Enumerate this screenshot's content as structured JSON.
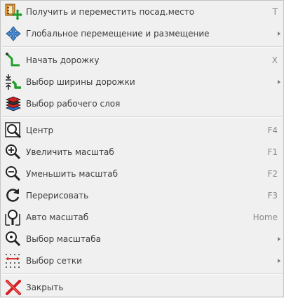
{
  "menu": {
    "items": [
      {
        "label": "Получить и переместить посад.место",
        "shortcut": "T",
        "icon": "get-footprint-icon"
      },
      {
        "label": "Глобальное перемещение и размещение",
        "shortcut": "",
        "icon": "move-arrows-icon",
        "submenu": true
      },
      {
        "label": "Начать дорожку",
        "shortcut": "X",
        "icon": "track-icon"
      },
      {
        "label": "Выбор ширины дорожки",
        "shortcut": "",
        "icon": "track-width-icon",
        "submenu": true
      },
      {
        "label": "Выбор рабочего слоя",
        "shortcut": "",
        "icon": "layers-icon"
      },
      {
        "label": "Центр",
        "shortcut": "F4",
        "icon": "zoom-center-icon"
      },
      {
        "label": "Увеличить масштаб",
        "shortcut": "F1",
        "icon": "zoom-in-icon"
      },
      {
        "label": "Уменьшить масштаб",
        "shortcut": "F2",
        "icon": "zoom-out-icon"
      },
      {
        "label": "Перерисовать",
        "shortcut": "F3",
        "icon": "redraw-icon"
      },
      {
        "label": "Авто масштаб",
        "shortcut": "Home",
        "icon": "zoom-fit-icon"
      },
      {
        "label": "Выбор масштаба",
        "shortcut": "",
        "icon": "zoom-select-icon",
        "submenu": true
      },
      {
        "label": "Выбор сетки",
        "shortcut": "",
        "icon": "grid-icon",
        "submenu": true
      },
      {
        "label": "Закрыть",
        "shortcut": "",
        "icon": "close-icon"
      }
    ]
  },
  "colors": {
    "background": "#f0f0f0",
    "text": "#3c3c3c",
    "shortcut": "#8a8a8a",
    "track_green": "#1f9e2a",
    "close_red": "#d42020"
  }
}
